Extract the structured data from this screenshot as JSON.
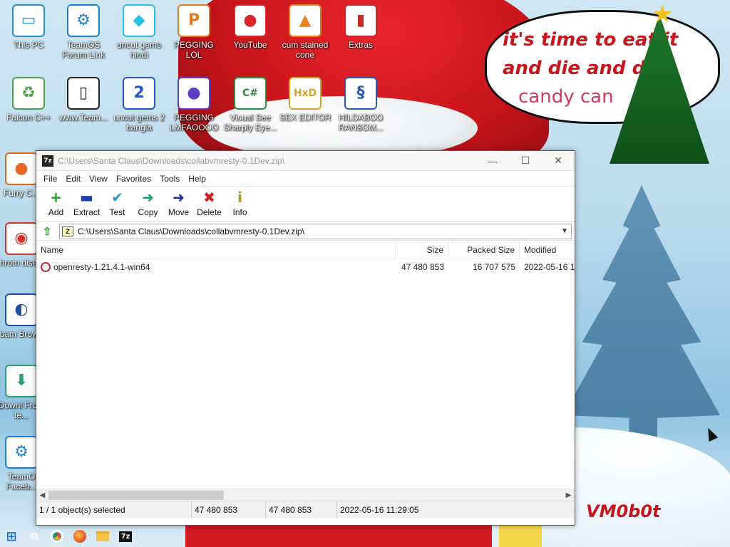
{
  "wallpaper": {
    "bubble_lines": [
      "it's time to eat it",
      "and die and d",
      "candy can"
    ],
    "signature": "VM0b0t"
  },
  "desktop_icons": [
    {
      "label": "This PC",
      "icon": "monitor-icon",
      "color": "#2b8fd6"
    },
    {
      "label": "TeamOS Forum Link",
      "icon": "gear-icon",
      "color": "#1f7fd0"
    },
    {
      "label": "uncut gems hindi",
      "icon": "diamond-icon",
      "color": "#27c1e8"
    },
    {
      "label": "PEGGING LOL",
      "icon": "p-logo-icon",
      "color": "#e07a20"
    },
    {
      "label": "YouTube",
      "icon": "angry-bird-icon",
      "color": "#d9262b"
    },
    {
      "label": "cum stained cone",
      "icon": "traffic-cone-icon",
      "color": "#e8831f"
    },
    {
      "label": "Extras",
      "icon": "book-icon",
      "color": "#c42a2a"
    },
    {
      "label": "Falcon C++",
      "icon": "recycle-icon",
      "color": "#4ca24c"
    },
    {
      "label": "www.Team...",
      "icon": "file-icon",
      "color": "#222222"
    },
    {
      "label": "uncut gems 2 bangla",
      "icon": "number-two-icon",
      "color": "#2157c6"
    },
    {
      "label": "PEGGING LMFAOOOO",
      "icon": "ornament-icon",
      "color": "#5d3cc4"
    },
    {
      "label": "Visual See Sharply Eye...",
      "icon": "csharp-icon",
      "color": "#2a8f3c"
    },
    {
      "label": "SEX EDITOR",
      "icon": "hxd-icon",
      "color": "#d9a02a"
    },
    {
      "label": "HILDABOO RANSOM...",
      "icon": "wg-script-icon",
      "color": "#2e58b8"
    },
    {
      "label": "Furry C...",
      "icon": "firefox-icon",
      "color": "#e8651f"
    },
    {
      "label": "Chrom disea...",
      "icon": "chrome-icon",
      "color": "#d93025"
    },
    {
      "label": "Obam Brows...",
      "icon": "obama-logo-icon",
      "color": "#1c4fa0"
    },
    {
      "label": "Downl From te...",
      "icon": "download-icon",
      "color": "#2aa36a"
    },
    {
      "label": "TeamO Faceb...",
      "icon": "gear-icon",
      "color": "#1f7fd0"
    }
  ],
  "window": {
    "title": "C:\\Users\\Santa Claus\\Downloads\\collabvmresty-0.1Dev.zip\\",
    "app_icon_text": "7z",
    "controls": {
      "minimize": "—",
      "maximize": "☐",
      "close": "✕"
    },
    "menu": [
      "File",
      "Edit",
      "View",
      "Favorites",
      "Tools",
      "Help"
    ],
    "toolbar": [
      {
        "label": "Add",
        "icon": "plus-icon",
        "glyph": "+",
        "color": "#1ea31e"
      },
      {
        "label": "Extract",
        "icon": "minus-icon",
        "glyph": "▬",
        "color": "#1d3fb0"
      },
      {
        "label": "Test",
        "icon": "checkmark-icon",
        "glyph": "✔",
        "color": "#1aa3b8"
      },
      {
        "label": "Copy",
        "icon": "copy-arrow-icon",
        "glyph": "➜",
        "color": "#1a9c7a"
      },
      {
        "label": "Move",
        "icon": "move-arrow-icon",
        "glyph": "➜",
        "color": "#1d2f9c"
      },
      {
        "label": "Delete",
        "icon": "delete-x-icon",
        "glyph": "✖",
        "color": "#d21f1f"
      },
      {
        "label": "Info",
        "icon": "info-icon",
        "glyph": "i",
        "color": "#b8960a"
      }
    ],
    "address": "C:\\Users\\Santa Claus\\Downloads\\collabvmresty-0.1Dev.zip\\",
    "columns": {
      "name": "Name",
      "size": "Size",
      "packed": "Packed Size",
      "modified": "Modified"
    },
    "files": [
      {
        "name": "openresty-1.21.4.1-win64",
        "size": "47 480 853",
        "packed": "16 707 575",
        "modified": "2022-05-16 1"
      }
    ],
    "status": {
      "selection": "1 / 1 object(s) selected",
      "size": "47 480 853",
      "size2": "47 480 853",
      "date": "2022-05-16 11:29:05"
    }
  },
  "taskbar": {
    "items": [
      {
        "name": "start-button",
        "icon": "windows-logo-icon"
      },
      {
        "name": "task-view",
        "icon": "task-view-icon"
      },
      {
        "name": "chrome",
        "icon": "chrome-icon"
      },
      {
        "name": "firefox",
        "icon": "firefox-icon"
      },
      {
        "name": "file-explorer",
        "icon": "folder-icon"
      },
      {
        "name": "7zip",
        "icon": "7zip-icon",
        "text": "7z"
      }
    ]
  }
}
